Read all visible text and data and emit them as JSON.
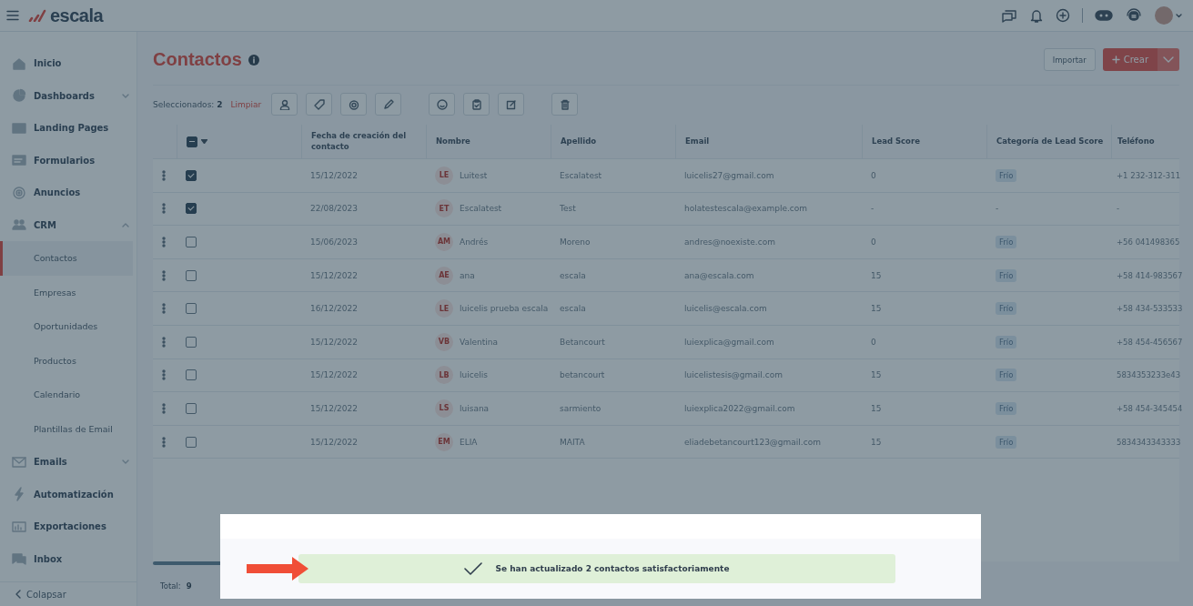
{
  "header": {
    "logo": "escala"
  },
  "sidebar": {
    "items": [
      {
        "label": "Inicio",
        "kind": "main"
      },
      {
        "label": "Dashboards",
        "kind": "main",
        "expanded": false
      },
      {
        "label": "Landing Pages",
        "kind": "main"
      },
      {
        "label": "Formularios",
        "kind": "main"
      },
      {
        "label": "Anuncios",
        "kind": "main"
      },
      {
        "label": "CRM",
        "kind": "main",
        "expanded": true,
        "children": [
          {
            "label": "Contactos",
            "selected": true
          },
          {
            "label": "Empresas",
            "selected": false
          },
          {
            "label": "Oportunidades",
            "selected": false
          },
          {
            "label": "Productos",
            "selected": false
          },
          {
            "label": "Calendario",
            "selected": false
          },
          {
            "label": "Plantillas de Email",
            "selected": false
          }
        ]
      },
      {
        "label": "Emails",
        "kind": "main",
        "expanded": false
      },
      {
        "label": "Automatización",
        "kind": "main"
      },
      {
        "label": "Exportaciones",
        "kind": "main"
      },
      {
        "label": "Inbox",
        "kind": "main"
      }
    ],
    "collapse": "Colapsar"
  },
  "page": {
    "title": "Contactos",
    "import_button": "Importar",
    "create_button": "Crear"
  },
  "selection": {
    "label": "Seleccionados:",
    "count": "2",
    "clear": "Limpiar"
  },
  "table": {
    "select_all_partial": true,
    "columns": [
      "Fecha de creación del contacto",
      "Nombre",
      "Apellido",
      "Email",
      "Lead Score",
      "Categoría de Lead Score",
      "Teléfono"
    ],
    "rows": [
      {
        "checked": true,
        "date": "15/12/2022",
        "initials": "LE",
        "name": "Luitest",
        "last_name": "Escalatest",
        "email": "luicelis27@gmail.com",
        "score": "0",
        "category": {
          "kind": "tag",
          "text": "Frío"
        },
        "phone": "+1 232-312-311"
      },
      {
        "checked": true,
        "date": "22/08/2023",
        "initials": "ET",
        "name": "Escalatest",
        "last_name": "Test",
        "email": "holatestescala@example.com",
        "score": "-",
        "category": {
          "kind": "plain",
          "text": "-"
        },
        "phone": "-"
      },
      {
        "checked": false,
        "date": "15/06/2023",
        "initials": "AM",
        "name": "Andrés",
        "last_name": "Moreno",
        "email": "andres@noexiste.com",
        "score": "0",
        "category": {
          "kind": "tag",
          "text": "Frío"
        },
        "phone": "+56 041498365"
      },
      {
        "checked": false,
        "date": "15/12/2022",
        "initials": "AE",
        "name": "ana",
        "last_name": "escala",
        "email": "ana@escala.com",
        "score": "15",
        "category": {
          "kind": "tag",
          "text": "Frío"
        },
        "phone": "+58 414-983567"
      },
      {
        "checked": false,
        "date": "16/12/2022",
        "initials": "LE",
        "name": "luicelis prueba escala",
        "last_name": "escala",
        "email": "luicelis@escala.com",
        "score": "15",
        "category": {
          "kind": "tag",
          "text": "Frío"
        },
        "phone": "+58 434-533533"
      },
      {
        "checked": false,
        "date": "15/12/2022",
        "initials": "VB",
        "name": "Valentina",
        "last_name": "Betancourt",
        "email": "luiexplica@gmail.com",
        "score": "0",
        "category": {
          "kind": "tag",
          "text": "Frío"
        },
        "phone": "+58 454-456567"
      },
      {
        "checked": false,
        "date": "15/12/2022",
        "initials": "LB",
        "name": "luicelis",
        "last_name": "betancourt",
        "email": "luicelistesis@gmail.com",
        "score": "15",
        "category": {
          "kind": "tag",
          "text": "Frío"
        },
        "phone": "5834353233e43"
      },
      {
        "checked": false,
        "date": "15/12/2022",
        "initials": "LS",
        "name": "luisana",
        "last_name": "sarmiento",
        "email": "luiexplica2022@gmail.com",
        "score": "15",
        "category": {
          "kind": "tag",
          "text": "Frío"
        },
        "phone": "+58 454-345454"
      },
      {
        "checked": false,
        "date": "15/12/2022",
        "initials": "EM",
        "name": "ELIA",
        "last_name": "MAITA",
        "email": "eliadebetancourt123@gmail.com",
        "score": "15",
        "category": {
          "kind": "tag",
          "text": "Frío"
        },
        "phone": "5834343343333"
      }
    ]
  },
  "footer": {
    "total_label": "Total:",
    "total": "9"
  },
  "toast": {
    "message": "Se han actualizado 2 contactos satisfactoriamente"
  }
}
